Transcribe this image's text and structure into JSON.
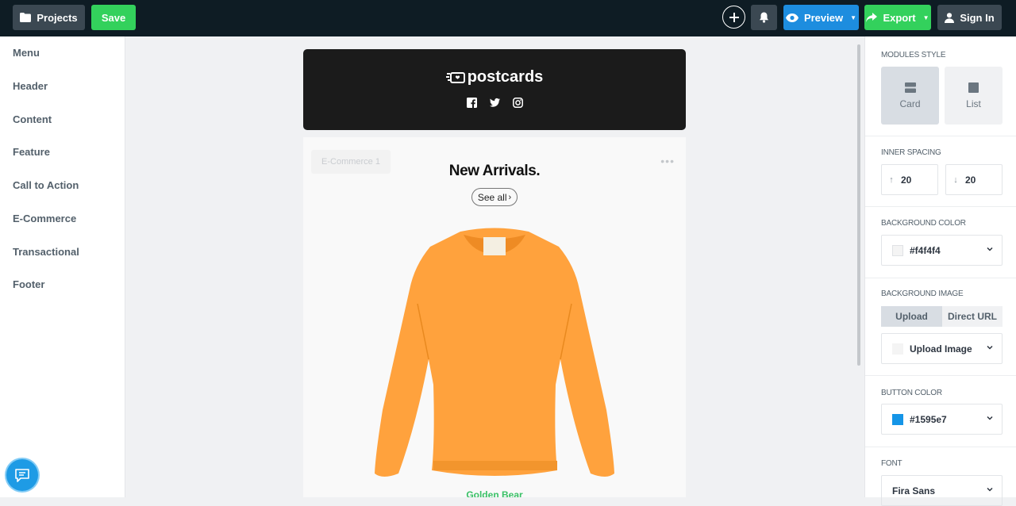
{
  "toolbar": {
    "projects_label": "Projects",
    "save_label": "Save",
    "preview_label": "Preview",
    "export_label": "Export",
    "signin_label": "Sign In"
  },
  "sidebar": {
    "items": [
      {
        "label": "Menu"
      },
      {
        "label": "Header"
      },
      {
        "label": "Content"
      },
      {
        "label": "Feature"
      },
      {
        "label": "Call to Action"
      },
      {
        "label": "E-Commerce"
      },
      {
        "label": "Transactional"
      },
      {
        "label": "Footer"
      }
    ]
  },
  "email": {
    "logo_text": "postcards",
    "social_icons": [
      "facebook-icon",
      "twitter-icon",
      "instagram-icon"
    ],
    "module_tag": "E-Commerce 1",
    "title": "New Arrivals.",
    "see_all": "See all",
    "product_name": "Golden Bear",
    "product_color": "#ffa23d"
  },
  "panel": {
    "modules_style": {
      "title": "MODULES STYLE",
      "options": [
        {
          "label": "Card",
          "selected": true
        },
        {
          "label": "List",
          "selected": false
        }
      ]
    },
    "inner_spacing": {
      "title": "INNER SPACING",
      "top": "20",
      "bottom": "20"
    },
    "background_color": {
      "title": "BACKGROUND COLOR",
      "value": "#f4f4f4"
    },
    "background_image": {
      "title": "BACKGROUND IMAGE",
      "tabs": [
        "Upload",
        "Direct URL"
      ],
      "active_tab": "Upload",
      "upload_label": "Upload Image"
    },
    "button_color": {
      "title": "BUTTON COLOR",
      "value": "#1595e7"
    },
    "font": {
      "title": "FONT",
      "value": "Fira Sans"
    }
  },
  "colors": {
    "topbar": "#0e1c24",
    "save_green": "#33d15c",
    "preview_blue": "#1d8ddf",
    "product_link_green": "#3ac167"
  }
}
